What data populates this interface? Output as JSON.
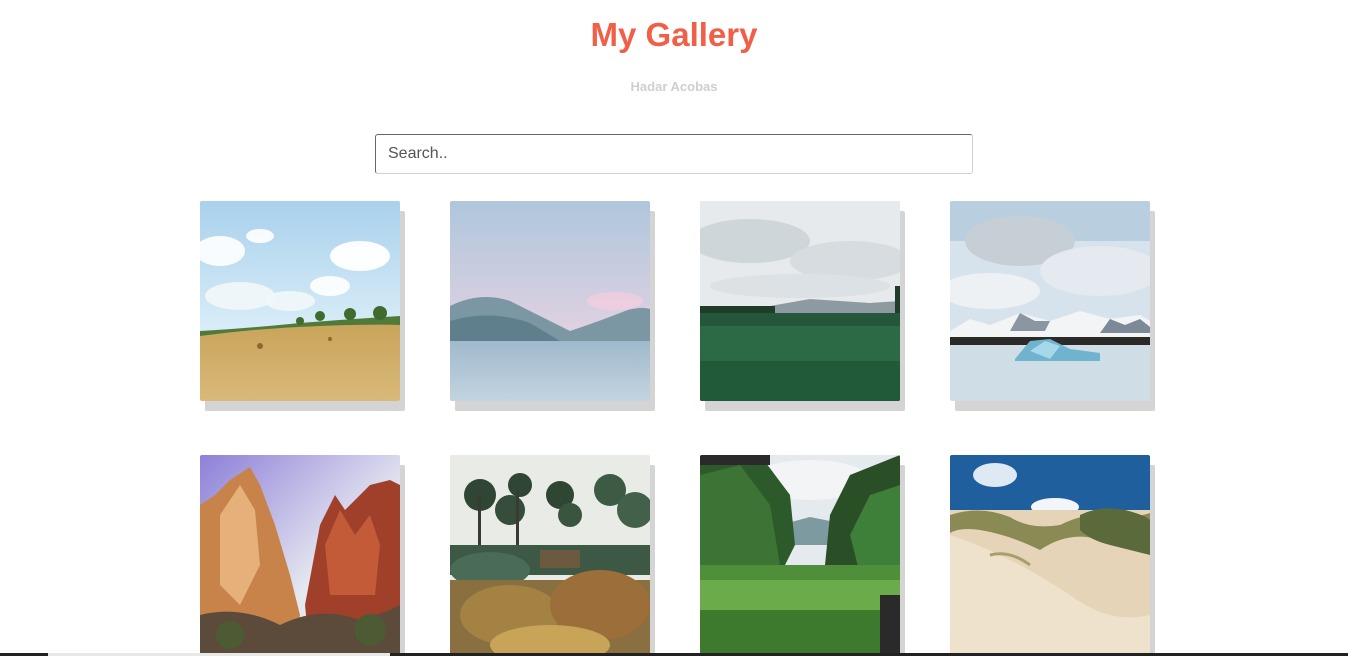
{
  "header": {
    "title": "My Gallery",
    "author": "Hadar Acobas"
  },
  "search": {
    "placeholder": "Search..",
    "value": ""
  },
  "colors": {
    "title": "#f05f46",
    "author": "#cfcfcf",
    "card_shadow": "#d4d4d4"
  },
  "gallery": {
    "items": [
      {
        "subject": "hay field under blue sky"
      },
      {
        "subject": "mountain lake at dusk"
      },
      {
        "subject": "green forest under clouds"
      },
      {
        "subject": "glacier lagoon with icebergs"
      },
      {
        "subject": "red rock canyon cliffs"
      },
      {
        "subject": "wild garden with trees"
      },
      {
        "subject": "jungle valley with stream"
      },
      {
        "subject": "sand dunes and grass"
      }
    ]
  }
}
